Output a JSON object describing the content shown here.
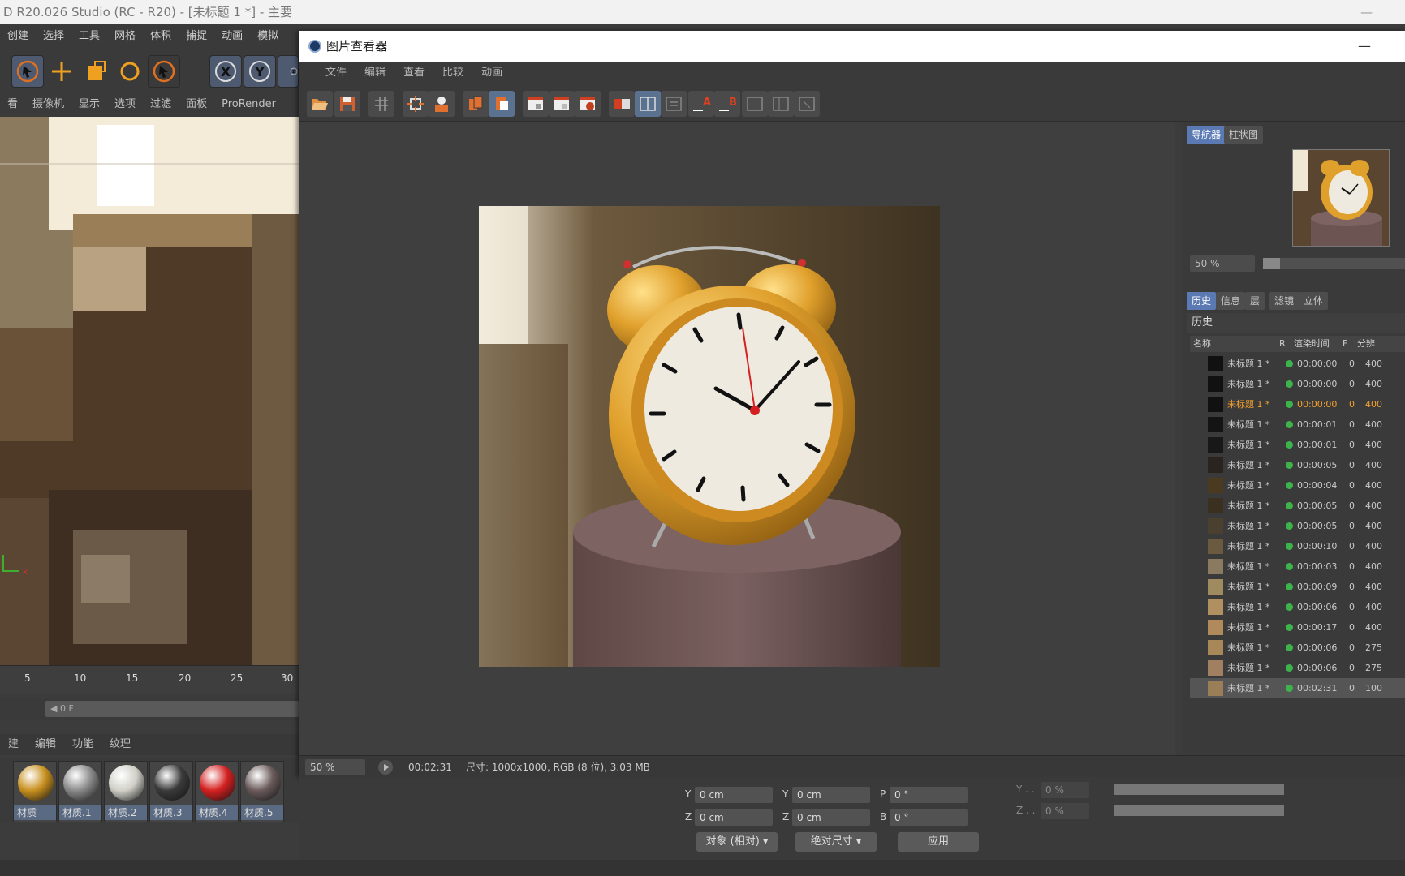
{
  "main_title": "D R20.026 Studio (RC - R20) - [未标题 1 *] - 主要",
  "main_menu": [
    "创建",
    "选择",
    "工具",
    "网格",
    "体积",
    "捕捉",
    "动画",
    "模拟"
  ],
  "view_menu": [
    "看",
    "摄像机",
    "显示",
    "选项",
    "过滤",
    "面板",
    "ProRender"
  ],
  "axis_buttons": [
    "X",
    "Y",
    "Z"
  ],
  "timeline_ticks": [
    "5",
    "10",
    "15",
    "20",
    "25",
    "30"
  ],
  "frame_field": "0 F",
  "material_tabs": [
    "建",
    "编辑",
    "功能",
    "纹理"
  ],
  "materials": [
    {
      "label": "材质",
      "color": "#c8901e"
    },
    {
      "label": "材质.1",
      "color": "#8a8a8a"
    },
    {
      "label": "材质.2",
      "color": "#d0d0c8"
    },
    {
      "label": "材质.3",
      "color": "#3a3a3a"
    },
    {
      "label": "材质.4",
      "color": "#d42020"
    },
    {
      "label": "材质.5",
      "color": "#6a5a5a"
    }
  ],
  "picture_viewer": {
    "title": "图片查看器",
    "menu": [
      "文件",
      "编辑",
      "查看",
      "比较",
      "动画"
    ],
    "status": {
      "zoom": "50 %",
      "time": "00:02:31",
      "info": "尺寸: 1000x1000, RGB (8 位), 3.03 MB"
    },
    "nav_tabs": [
      "导航器",
      "柱状图"
    ],
    "nav_zoom": "50 %",
    "nav_zoom_fraction": 0.12,
    "panel_tabs": [
      "历史",
      "信息",
      "层",
      "滤镜",
      "立体"
    ],
    "history_title": "历史",
    "history_columns": {
      "name": "名称",
      "r": "R",
      "time": "渲染时间",
      "f": "F",
      "res": "分辨"
    },
    "history": [
      {
        "name": "未标题 1 *",
        "time": "00:00:00",
        "f": "0",
        "res": "400"
      },
      {
        "name": "未标题 1 *",
        "time": "00:00:00",
        "f": "0",
        "res": "400"
      },
      {
        "name": "未标题 1 *",
        "time": "00:00:00",
        "f": "0",
        "res": "400"
      },
      {
        "name": "未标题 1 *",
        "time": "00:00:01",
        "f": "0",
        "res": "400"
      },
      {
        "name": "未标题 1 *",
        "time": "00:00:01",
        "f": "0",
        "res": "400"
      },
      {
        "name": "未标题 1 *",
        "time": "00:00:05",
        "f": "0",
        "res": "400"
      },
      {
        "name": "未标题 1 *",
        "time": "00:00:04",
        "f": "0",
        "res": "400"
      },
      {
        "name": "未标题 1 *",
        "time": "00:00:05",
        "f": "0",
        "res": "400"
      },
      {
        "name": "未标题 1 *",
        "time": "00:00:05",
        "f": "0",
        "res": "400"
      },
      {
        "name": "未标题 1 *",
        "time": "00:00:10",
        "f": "0",
        "res": "400"
      },
      {
        "name": "未标题 1 *",
        "time": "00:00:03",
        "f": "0",
        "res": "400"
      },
      {
        "name": "未标题 1 *",
        "time": "00:00:09",
        "f": "0",
        "res": "400"
      },
      {
        "name": "未标题 1 *",
        "time": "00:00:06",
        "f": "0",
        "res": "400"
      },
      {
        "name": "未标题 1 *",
        "time": "00:00:17",
        "f": "0",
        "res": "400"
      },
      {
        "name": "未标题 1 *",
        "time": "00:00:06",
        "f": "0",
        "res": "275"
      },
      {
        "name": "未标题 1 *",
        "time": "00:00:06",
        "f": "0",
        "res": "275"
      },
      {
        "name": "未标题 1 *",
        "time": "00:02:31",
        "f": "0",
        "res": "100"
      }
    ],
    "selected_row": 2
  },
  "coords": {
    "y_pos": "0 cm",
    "z_pos": "0 cm",
    "y_size": "0 cm",
    "z_size": "0 cm",
    "p_rot": "0 °",
    "b_rot": "0 °",
    "labels": {
      "y": "Y",
      "z": "Z",
      "p": "P",
      "b": "B"
    },
    "mode_select": "对象 (相对)",
    "size_select": "绝对尺寸",
    "apply": "应用",
    "right_y": "0 %",
    "right_z": "0 %",
    "right_y_label": "Y . .",
    "right_z_label": "Z . ."
  }
}
